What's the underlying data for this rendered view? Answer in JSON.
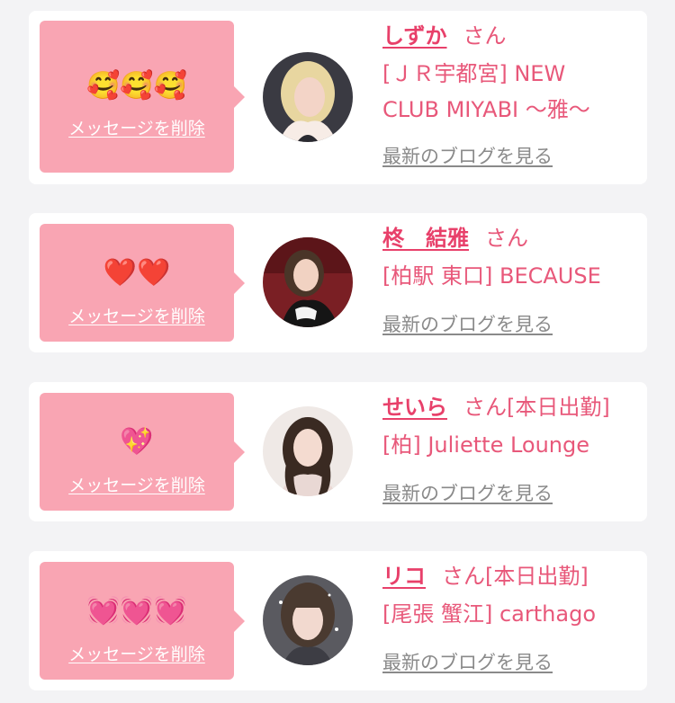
{
  "cards": [
    {
      "emoji": "🥰🥰🥰",
      "delete_label": "メッセージを削除",
      "name": "しずか",
      "honorific": "さん",
      "status": "",
      "shop_lines": [
        "[ＪＲ宇都宮] NEW",
        "CLUB MIYABI 〜雅〜"
      ],
      "blog_label": "最新のブログを見る"
    },
    {
      "emoji": "❤️❤️",
      "delete_label": "メッセージを削除",
      "name": "柊　結雅",
      "honorific": "さん",
      "status": "",
      "shop_lines": [
        "[柏駅 東口] BECAUSE"
      ],
      "blog_label": "最新のブログを見る"
    },
    {
      "emoji": "💖",
      "delete_label": "メッセージを削除",
      "name": "せいら",
      "honorific": "さん",
      "status": "[本日出勤]",
      "shop_lines": [
        "[柏] Juliette Lounge"
      ],
      "blog_label": "最新のブログを見る"
    },
    {
      "emoji": "💓💓💓",
      "delete_label": "メッセージを削除",
      "name": "リコ",
      "honorific": "さん",
      "status": "[本日出勤]",
      "shop_lines": [
        "[尾張 蟹江] carthago"
      ],
      "blog_label": "最新のブログを見る"
    }
  ],
  "colors": {
    "bubble": "#f9a5b3",
    "accent": "#e8406a",
    "text_pink": "#e8587a",
    "link_gray": "#8a8a8a",
    "background": "#f3f3f5"
  }
}
